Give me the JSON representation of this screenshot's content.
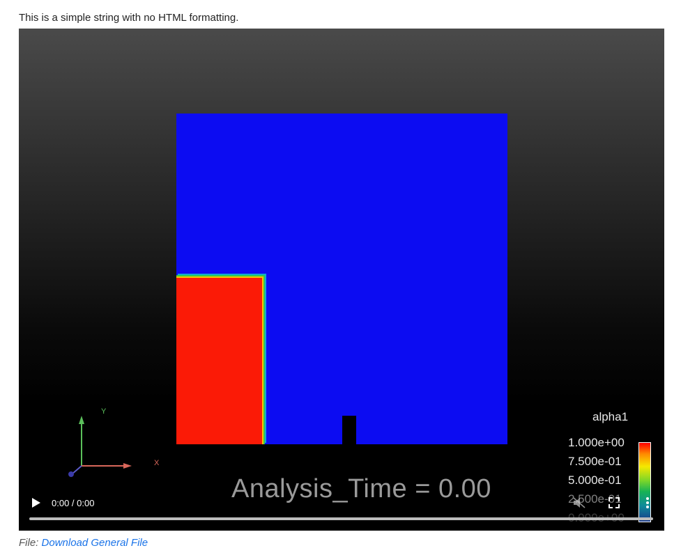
{
  "intro_text": "This is a simple string with no HTML formatting.",
  "video": {
    "axes": {
      "y_label": "Y",
      "x_label": "X"
    },
    "analysis_time_text": "Analysis_Time = 0.00",
    "legend": {
      "title": "alpha1",
      "labels": [
        "1.000e+00",
        "7.500e-01",
        "5.000e-01",
        "2.500e-01",
        "0.000e+00"
      ]
    },
    "controls": {
      "time": "0:00 / 0:00"
    },
    "colors": {
      "fluid_blue": "#0c0cf2",
      "water_red": "#fb1a06"
    }
  },
  "caption": {
    "prefix": "File:",
    "link_text": "Download General File"
  }
}
